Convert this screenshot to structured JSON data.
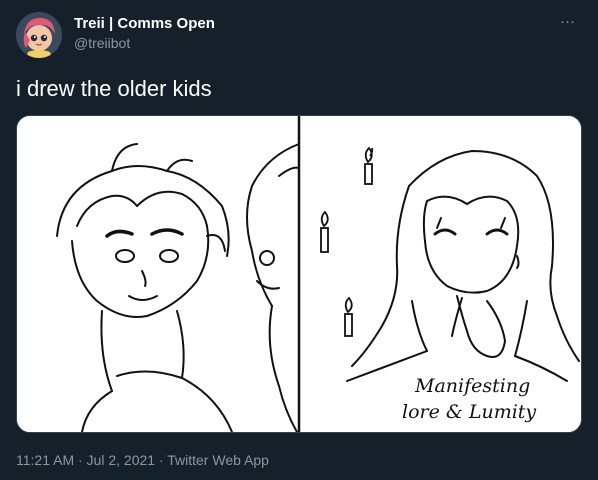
{
  "tweet": {
    "display_name": "Treii | Comms Open",
    "handle": "@treiibot",
    "text": "i drew the older kids",
    "meta": "11:21 AM · Jul 2, 2021 · Twitter Web App",
    "more_icon": "…"
  },
  "media": {
    "caption_line1": "Manifesting",
    "caption_line2": "lore & Lumity"
  },
  "colors": {
    "background": "#15202b",
    "secondary_text": "#8899a6",
    "border": "#38444d"
  },
  "icons": [
    "more-icon",
    "avatar",
    "candle-icon"
  ]
}
